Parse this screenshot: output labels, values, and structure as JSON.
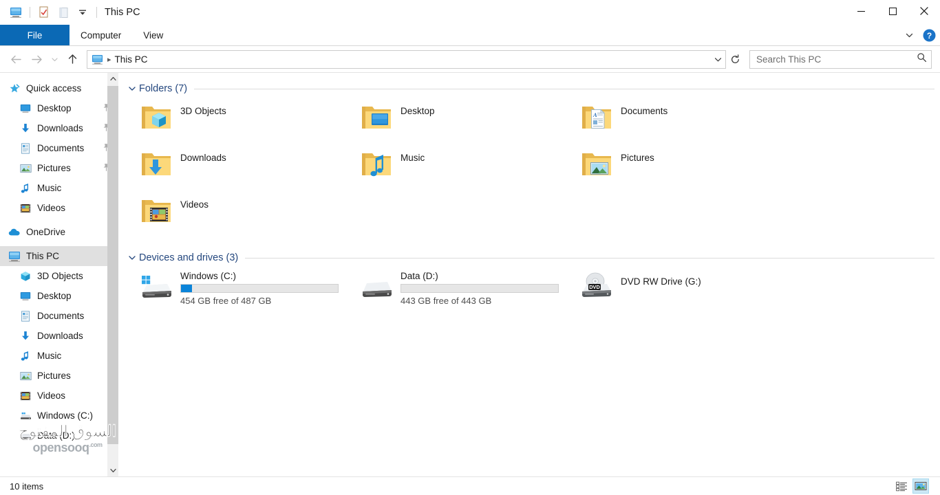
{
  "window": {
    "title": "This PC",
    "quick_access_toolbar": [
      {
        "name": "this-pc-icon",
        "label": "This PC"
      },
      {
        "name": "properties-icon",
        "label": "Properties"
      },
      {
        "name": "new-folder-icon",
        "label": "New folder"
      },
      {
        "name": "customize-dropdown-icon",
        "label": "Customize Quick Access Toolbar"
      }
    ],
    "controls": {
      "minimize": "Minimize",
      "maximize": "Maximize",
      "close": "Close"
    }
  },
  "ribbon": {
    "tabs": [
      {
        "label": "File",
        "active": true
      },
      {
        "label": "Computer",
        "active": false
      },
      {
        "label": "View",
        "active": false
      }
    ],
    "collapse_label": "Minimize the Ribbon",
    "help_label": "Help"
  },
  "address_bar": {
    "back_label": "Back",
    "forward_label": "Forward",
    "recent_label": "Recent locations",
    "up_label": "Up to Desktop",
    "breadcrumb": [
      {
        "icon": "this-pc-icon",
        "label": "This PC"
      }
    ],
    "path_text": "This PC",
    "dropdown_label": "Previous locations",
    "refresh_label": "Refresh"
  },
  "search": {
    "placeholder": "Search This PC",
    "value": ""
  },
  "sidebar": {
    "groups": [
      {
        "name": "quick-access",
        "label": "Quick access",
        "icon": "star-icon",
        "level": 0,
        "items": [
          {
            "label": "Desktop",
            "icon": "desktop-icon",
            "pinned": true
          },
          {
            "label": "Downloads",
            "icon": "downloads-icon",
            "pinned": true
          },
          {
            "label": "Documents",
            "icon": "documents-icon",
            "pinned": true
          },
          {
            "label": "Pictures",
            "icon": "pictures-icon",
            "pinned": true
          },
          {
            "label": "Music",
            "icon": "music-icon",
            "pinned": false
          },
          {
            "label": "Videos",
            "icon": "videos-icon",
            "pinned": false
          }
        ]
      },
      {
        "name": "onedrive",
        "label": "OneDrive",
        "icon": "cloud-icon",
        "level": 0,
        "items": []
      },
      {
        "name": "this-pc",
        "label": "This PC",
        "icon": "this-pc-icon",
        "level": 0,
        "selected": true,
        "items": [
          {
            "label": "3D Objects",
            "icon": "3d-objects-icon",
            "pinned": false
          },
          {
            "label": "Desktop",
            "icon": "desktop-icon",
            "pinned": false
          },
          {
            "label": "Documents",
            "icon": "documents-icon",
            "pinned": false
          },
          {
            "label": "Downloads",
            "icon": "downloads-icon",
            "pinned": false
          },
          {
            "label": "Music",
            "icon": "music-icon",
            "pinned": false
          },
          {
            "label": "Pictures",
            "icon": "pictures-icon",
            "pinned": false
          },
          {
            "label": "Videos",
            "icon": "videos-icon",
            "pinned": false
          },
          {
            "label": "Windows (C:)",
            "icon": "drive-icon",
            "pinned": false
          },
          {
            "label": "Data (D:)",
            "icon": "drive-icon",
            "pinned": false
          }
        ]
      }
    ],
    "scrollbar": {
      "up": "Scroll up",
      "down": "Scroll down"
    }
  },
  "main": {
    "folders_group": {
      "title": "Folders (7)",
      "items": [
        {
          "label": "3D Objects",
          "icon": "folder-3d-objects-icon"
        },
        {
          "label": "Desktop",
          "icon": "folder-desktop-icon"
        },
        {
          "label": "Documents",
          "icon": "folder-documents-icon"
        },
        {
          "label": "Downloads",
          "icon": "folder-downloads-icon"
        },
        {
          "label": "Music",
          "icon": "folder-music-icon"
        },
        {
          "label": "Pictures",
          "icon": "folder-pictures-icon"
        },
        {
          "label": "Videos",
          "icon": "folder-videos-icon"
        }
      ]
    },
    "drives_group": {
      "title": "Devices and drives (3)",
      "items": [
        {
          "label": "Windows (C:)",
          "icon": "windows-drive-icon",
          "has_bar": true,
          "used_percent": 7,
          "free_text": "454 GB free of 487 GB"
        },
        {
          "label": "Data (D:)",
          "icon": "drive-icon",
          "has_bar": true,
          "used_percent": 0,
          "free_text": "443 GB free of 443 GB"
        },
        {
          "label": "DVD RW Drive (G:)",
          "icon": "dvd-drive-icon",
          "has_bar": false,
          "used_percent": 0,
          "free_text": ""
        }
      ]
    }
  },
  "status_bar": {
    "item_count": "10 items",
    "details_view_label": "Details view",
    "large_icons_view_label": "Large icons view"
  },
  "watermark": {
    "arabic": "السوق المفتوح",
    "english": "opensooq",
    "suffix": ".com"
  },
  "colors": {
    "accent": "#0b69b5",
    "group_title": "#24477e",
    "selection": "#e0e0e0",
    "drive_bar": "#0b84d9",
    "help_blue": "#1a73c8"
  }
}
